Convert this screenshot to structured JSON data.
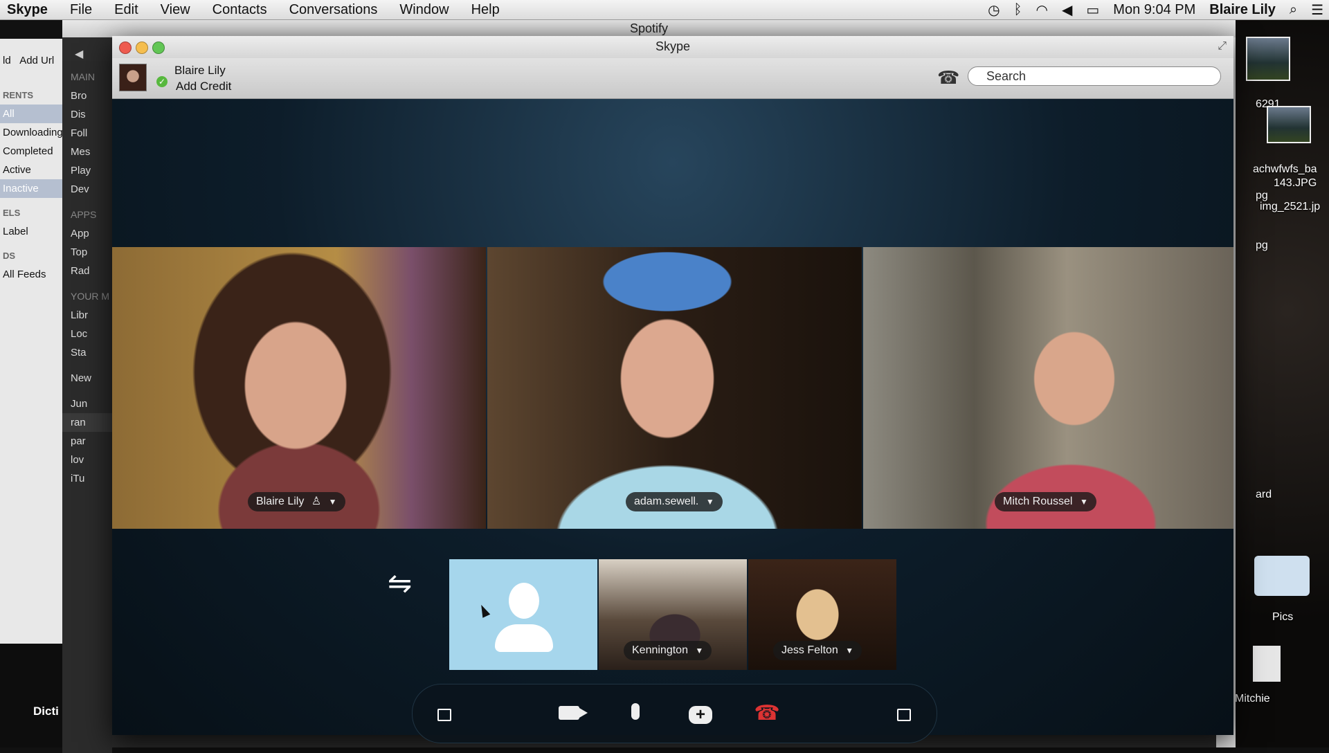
{
  "menubar": {
    "app_name": "Skype",
    "items": [
      "File",
      "Edit",
      "View",
      "Contacts",
      "Conversations",
      "Window",
      "Help"
    ],
    "clock": "Mon 9:04 PM",
    "user": "Blaire Lily"
  },
  "left_app": {
    "toolbar_label": "Add Url",
    "toolbar_label2": "ld",
    "header_torrents": "RENTS",
    "items": [
      "All",
      "Downloading",
      "Completed",
      "Active",
      "Inactive"
    ],
    "header_labels": "ELS",
    "label_item": "Label",
    "header_feeds": "DS",
    "feeds_item": "All Feeds",
    "bottom_label": "Dicti"
  },
  "spotify": {
    "title": "Spotify",
    "header_main": "MAIN",
    "main_items": [
      "Bro",
      "Dis",
      "Foll",
      "Mes",
      "Play",
      "Dev"
    ],
    "header_apps": "APPS",
    "app_items": [
      "App",
      "Top",
      "Rad"
    ],
    "header_your": "YOUR M",
    "your_items": [
      "Libr",
      "Loc",
      "Sta"
    ],
    "new_label": "New",
    "playlists": [
      "Jun",
      "ran",
      "par",
      "lov",
      "iTu"
    ]
  },
  "desktop": {
    "thumb1_label": "6291",
    "file1": "achwfwfs_ba",
    "file1b": "143.JPG",
    "file2": "pg",
    "file3": "img_2521.jp",
    "file4": "pg",
    "file5": "ard",
    "folder1": "Pics",
    "folder2": "Mitchie"
  },
  "skype": {
    "title": "Skype",
    "user_name": "Blaire Lily",
    "credit_label": "Add Credit",
    "search_placeholder": "Search",
    "participants": [
      {
        "name": "Blaire Lily"
      },
      {
        "name": "adam.sewell."
      },
      {
        "name": "Mitch Roussel"
      }
    ],
    "small_participants": [
      {
        "name": "Kennington"
      },
      {
        "name": "Jess Felton"
      }
    ],
    "accent": "#57b83e",
    "hangup_color": "#dd3333"
  }
}
